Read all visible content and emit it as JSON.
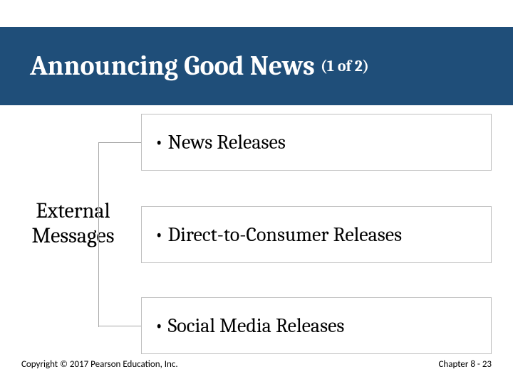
{
  "title": {
    "main": "Announcing Good News",
    "suffix": "(1 of 2)"
  },
  "diagram": {
    "category_label_line1": "External",
    "category_label_line2": "Messages",
    "items": [
      "• News Releases",
      "• Direct-to-Consumer Releases",
      "• Social Media Releases"
    ]
  },
  "footer": {
    "left": "Copyright © 2017 Pearson Education, Inc.",
    "right": "Chapter 8 - 23"
  }
}
